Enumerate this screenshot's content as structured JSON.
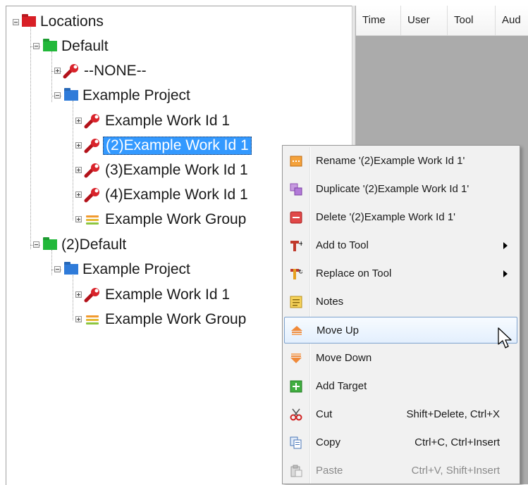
{
  "tree": {
    "root": "Locations",
    "default_1": "Default",
    "none": "--NONE--",
    "project_1": "Example Project",
    "work_1": "Example Work Id 1",
    "work_2": "(2)Example Work Id 1",
    "work_3": "(3)Example Work Id 1",
    "work_4": "(4)Example Work Id 1",
    "group_1": "Example Work Group",
    "default_2": "(2)Default",
    "project_2": "Example Project",
    "work_5": "Example Work Id 1",
    "group_2": "Example Work Group"
  },
  "grid": {
    "columns": [
      "Time",
      "User",
      "Tool",
      "Aud"
    ]
  },
  "context_menu": {
    "rename": "Rename '(2)Example Work Id 1'",
    "duplicate": "Duplicate '(2)Example Work Id 1'",
    "delete": "Delete '(2)Example Work Id 1'",
    "add_to_tool": "Add to Tool",
    "replace_on_tool": "Replace on Tool",
    "notes": "Notes",
    "move_up": "Move Up",
    "move_down": "Move Down",
    "add_target": "Add Target",
    "cut": "Cut",
    "cut_shortcut": "Shift+Delete, Ctrl+X",
    "copy": "Copy",
    "copy_shortcut": "Ctrl+C, Ctrl+Insert",
    "paste": "Paste",
    "paste_shortcut": "Ctrl+V, Shift+Insert"
  },
  "colors": {
    "selection": "#3399ff",
    "root_folder": "#d81f26",
    "location_folder": "#22b83a",
    "project_folder": "#2f7bd9",
    "grid_background": "#ababab"
  }
}
